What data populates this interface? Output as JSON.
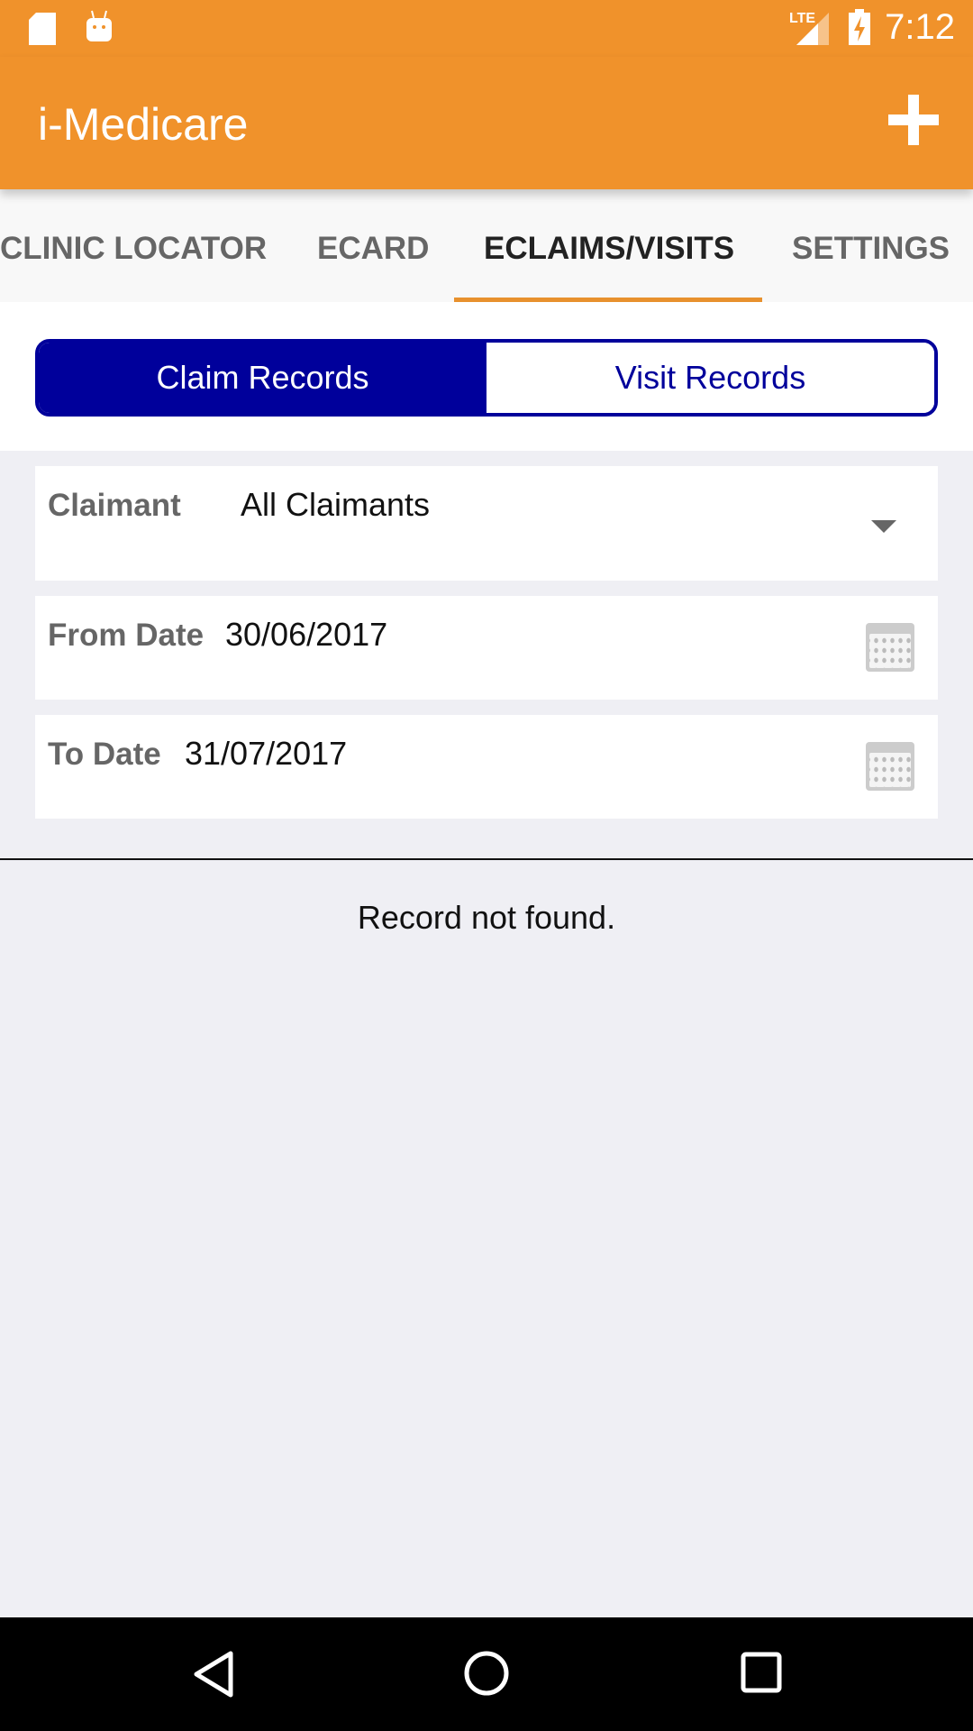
{
  "status_bar": {
    "time": "7:12",
    "network": "LTE",
    "icons": [
      "sd-card-icon",
      "android-icon",
      "signal-icon",
      "battery-charging-icon"
    ]
  },
  "app_bar": {
    "title": "i-Medicare",
    "action_icon": "plus-icon"
  },
  "tabs": [
    {
      "label": "CLINIC LOCATOR"
    },
    {
      "label": "ECARD"
    },
    {
      "label": "ECLAIMS/VISITS",
      "active": true
    },
    {
      "label": "SETTINGS"
    }
  ],
  "segment": {
    "claim": "Claim Records",
    "visit": "Visit Records",
    "selected": "Claim Records"
  },
  "filters": {
    "claimant": {
      "label": "Claimant",
      "value": "All Claimants"
    },
    "from": {
      "label": "From Date",
      "value": "30/06/2017"
    },
    "to": {
      "label": "To Date",
      "value": "31/07/2017"
    }
  },
  "empty_message": "Record not found.",
  "colors": {
    "primary": "#f0922b",
    "accent": "#00009b"
  }
}
